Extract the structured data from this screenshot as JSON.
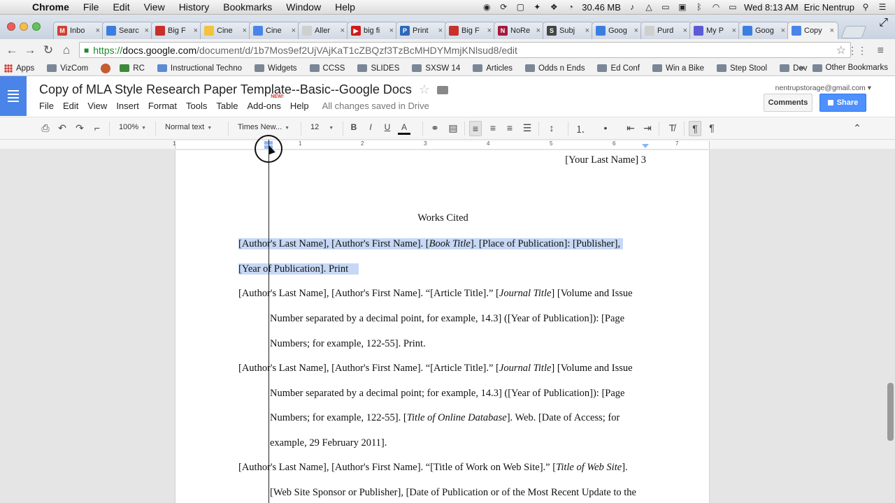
{
  "mac_menubar": {
    "app": "Chrome",
    "menus": [
      "File",
      "Edit",
      "View",
      "History",
      "Bookmarks",
      "Window",
      "Help"
    ],
    "memory": "30.46 MB",
    "clock": "Wed 8:13 AM",
    "user": "Eric Nentrup"
  },
  "tabs": [
    {
      "label": "Inbo",
      "fav": "M",
      "color": "#d23f31"
    },
    {
      "label": "Searc",
      "fav": "",
      "color": "#3c7ee0"
    },
    {
      "label": "Big F",
      "fav": "",
      "color": "#c8302b"
    },
    {
      "label": "Cine",
      "fav": "",
      "color": "#f3c33c"
    },
    {
      "label": "Cine",
      "fav": "",
      "color": "#4a84e8"
    },
    {
      "label": "Aller",
      "fav": "",
      "color": "#cfcfcf"
    },
    {
      "label": "big fi",
      "fav": "▶",
      "color": "#d11a1a"
    },
    {
      "label": "Print",
      "fav": "P",
      "color": "#2d6ab8"
    },
    {
      "label": "Big F",
      "fav": "",
      "color": "#c8302b"
    },
    {
      "label": "NoRe",
      "fav": "N",
      "color": "#a11a3c"
    },
    {
      "label": "Subj",
      "fav": "S",
      "color": "#444444"
    },
    {
      "label": "Goog",
      "fav": "",
      "color": "#3c7ee0"
    },
    {
      "label": "Purd",
      "fav": "",
      "color": "#cfcfcf"
    },
    {
      "label": "My P",
      "fav": "",
      "color": "#5b5bd6"
    },
    {
      "label": "Goog",
      "fav": "",
      "color": "#3c7ee0"
    },
    {
      "label": "Copy",
      "fav": "",
      "color": "#4a84e8",
      "active": true
    }
  ],
  "address": {
    "scheme": "https://",
    "host": "docs.google.com",
    "path": "/document/d/1b7Mos9ef2UjVAjKaT1cZBQzf3TzBcMHDYMmjKNlsud8/edit"
  },
  "bookmarks": [
    "Apps",
    "VizCom",
    "RC",
    "Instructional Techno",
    "Widgets",
    "CCSS",
    "SLIDES",
    "SXSW 14",
    "Articles",
    "Odds n Ends",
    "Ed Conf",
    "Win a Bike",
    "Step Stool",
    "Dev"
  ],
  "other_bookmarks": "Other Bookmarks",
  "docs": {
    "title": "Copy of MLA Style Research Paper Template--Basic--Google Docs",
    "menus": [
      "File",
      "Edit",
      "View",
      "Insert",
      "Format",
      "Tools",
      "Table",
      "Add-ons",
      "Help"
    ],
    "new_badge": "NEW!",
    "saved_status": "All changes saved in Drive",
    "email": "nentrupstorage@gmail.com",
    "comments_label": "Comments",
    "share_label": "Share"
  },
  "format_toolbar": {
    "zoom": "100%",
    "style": "Normal text",
    "font": "Times New...",
    "size": "12"
  },
  "ruler_numbers": [
    "1",
    "1",
    "2",
    "3",
    "4",
    "5",
    "6",
    "7"
  ],
  "document": {
    "header": "[Your Last Name] 3",
    "heading": "Works Cited",
    "entry1_line1_a": "[Author's Last Name], [Author's First Name]. [",
    "entry1_line1_it": "Book Title",
    "entry1_line1_b": "]. [Place of Publication]: [Publisher],",
    "entry1_line2": "[Year of Publication]. Print",
    "entry2_line1_a": "[Author's Last Name], [Author's First Name]. “[Article Title].” [",
    "entry2_line1_it": "Journal Title",
    "entry2_line1_b": "] [Volume and Issue",
    "entry2_line2": "Number separated by a decimal point, for example, 14.3] ([Year of Publication]): [Page",
    "entry2_line3": "Numbers; for example, 122-55]. Print.",
    "entry3_line1_a": "[Author's Last Name], [Author's First Name]. “[Article Title].” [",
    "entry3_line1_it": "Journal Title",
    "entry3_line1_b": "] [Volume and Issue",
    "entry3_line2": "Number separated by a decimal point; for example, 14.3] ([Year of Publication]): [Page",
    "entry3_line3_a": "Numbers; for example, 122-55]. [",
    "entry3_line3_it": "Title of Online Database",
    "entry3_line3_b": "]. Web. [Date of Access; for",
    "entry3_line4": "example, 29 February 2011].",
    "entry4_line1_a": "[Author's Last Name], [Author's First Name]. “[Title of Work on Web Site].” [",
    "entry4_line1_it": "Title of Web Site",
    "entry4_line1_b": "].",
    "entry4_line2": "[Web Site Sponsor or Publisher], [Date of Publication or of the Most Recent Update to the"
  }
}
